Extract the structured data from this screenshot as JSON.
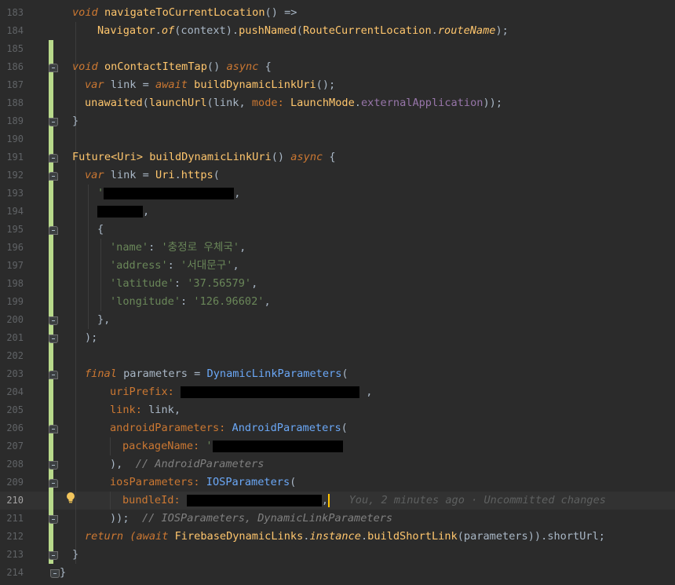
{
  "editor": {
    "current_line_number": "210",
    "line_numbers": [
      "183",
      "184",
      "185",
      "186",
      "187",
      "188",
      "189",
      "190",
      "191",
      "192",
      "193",
      "194",
      "195",
      "196",
      "197",
      "198",
      "199",
      "200",
      "201",
      "202",
      "203",
      "204",
      "205",
      "206",
      "207",
      "208",
      "209",
      "210",
      "211",
      "212",
      "213",
      "214"
    ],
    "tokens": {
      "void": "void",
      "navigate_fn": "navigateToCurrentLocation",
      "parens_arrow": "() =>",
      "navigator": "Navigator",
      "dot": ".",
      "of": "of",
      "context_arg": "(context)",
      "push_named": "pushNamed",
      "route_class": "RouteCurrentLocation",
      "route_name": "routeName",
      "close_semi": ");",
      "on_contact_fn": "onContactItemTap",
      "parens": "()",
      "async": "async",
      "brace_open": "{",
      "var": "var",
      "link_eq": "link =",
      "await": "await",
      "build_link_call": "buildDynamicLinkUri",
      "unawaited": "unawaited",
      "launch_url": "launchUrl",
      "link_comma": "(link,",
      "mode_named": "mode:",
      "launch_mode": "LaunchMode",
      "external_app": "externalApplication",
      "close_double_semi": "));",
      "brace_close": "}",
      "future": "Future",
      "uri_generic": "<Uri>",
      "build_link_decl": "buildDynamicLinkUri",
      "uri_https": "Uri",
      "https": "https",
      "open_paren": "(",
      "quote": "'",
      "comma": ",",
      "key_name": "'name'",
      "val_name": "'충정로 우체국'",
      "key_address": "'address'",
      "val_address": "'서대문구'",
      "key_latitude": "'latitude'",
      "val_latitude": "'37.56579'",
      "key_longitude": "'longitude'",
      "val_longitude": "'126.96602'",
      "colon": ":",
      "close_brace_comma": "},",
      "final": "final",
      "parameters_eq": "parameters =",
      "dyn_link_params": "DynamicLinkParameters",
      "uri_prefix": "uriPrefix:",
      "link_named": "link:",
      "link_value": "link,",
      "android_params_named": "androidParameters:",
      "android_params_class": "AndroidParameters",
      "package_name": "packageName:",
      "close_paren_comma": "),",
      "android_comment": "// AndroidParameters",
      "ios_params_named": "iosParameters:",
      "ios_params_class": "IOSParameters",
      "bundle_id": "bundleId:",
      "ios_comment": "// IOSParameters, DynamicLinkParameters",
      "return": "return",
      "await_open": "(await",
      "firebase": "FirebaseDynamicLinks",
      "instance": "instance",
      "build_short": "buildShortLink",
      "params_arg": "(parameters))",
      "short_url": "shortUrl",
      "semi": ";"
    },
    "blame_annotation": "You, 2 minutes ago · Uncommitted changes"
  },
  "colors": {
    "background": "#2b2b2b",
    "keyword": "#cc7832",
    "function": "#ffc66d",
    "string": "#6a8759",
    "class": "#6ba8f7",
    "property": "#9876aa",
    "comment": "#629755",
    "change_bar": "#b8d98b",
    "caret": "#ffc300"
  },
  "icons": {
    "intention_bulb": "lightbulb-icon",
    "fold_marker": "fold-icon"
  }
}
